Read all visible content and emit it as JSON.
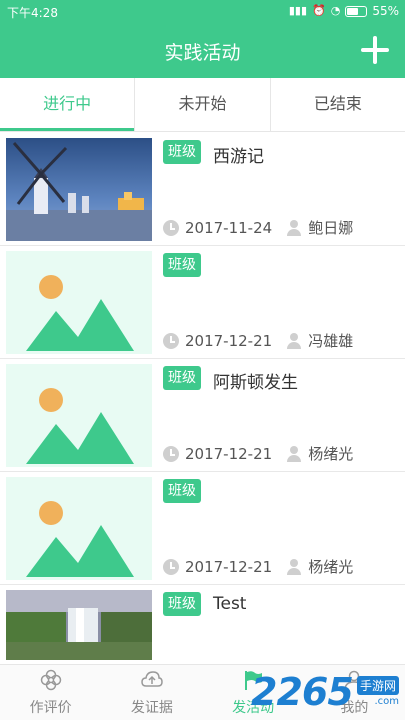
{
  "status_bar": {
    "time": "下午4:28",
    "battery": "55%"
  },
  "app_bar": {
    "title": "实践活动"
  },
  "tabs": [
    {
      "label": "进行中",
      "active": true
    },
    {
      "label": "未开始",
      "active": false
    },
    {
      "label": "已结束",
      "active": false
    }
  ],
  "activities": [
    {
      "badge": "班级",
      "name": "西游记",
      "date": "2017-11-24",
      "author": "鲍日娜",
      "image": "windmill-photo"
    },
    {
      "badge": "班级",
      "name": "",
      "date": "2017-12-21",
      "author": "冯雄雄",
      "image": "placeholder"
    },
    {
      "badge": "班级",
      "name": "阿斯顿发生",
      "date": "2017-12-21",
      "author": "杨绪光",
      "image": "placeholder"
    },
    {
      "badge": "班级",
      "name": "",
      "date": "2017-12-21",
      "author": "杨绪光",
      "image": "placeholder"
    },
    {
      "badge": "班级",
      "name": "Test",
      "date": "",
      "author": "",
      "image": "waterfall-photo"
    }
  ],
  "bottom_nav": [
    {
      "label": "作评价",
      "icon": "flower-icon",
      "active": false
    },
    {
      "label": "发证据",
      "icon": "cloud-upload-icon",
      "active": false
    },
    {
      "label": "发活动",
      "icon": "flag-icon",
      "active": true
    },
    {
      "label": "我的",
      "icon": "user-icon",
      "active": false
    }
  ],
  "watermark": {
    "number": "2265",
    "tag": "手游网",
    "url": ".com"
  },
  "colors": {
    "primary": "#3ec98c",
    "placeholder_bg": "#e8fbf3",
    "placeholder_sun": "#f0b15b"
  }
}
